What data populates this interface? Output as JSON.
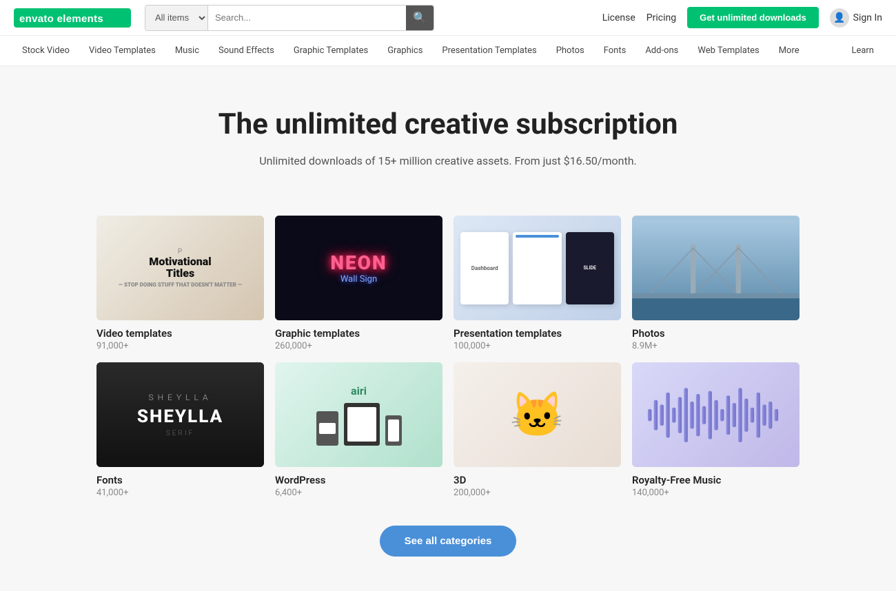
{
  "logo": {
    "text": "envato elements"
  },
  "search": {
    "dropdown_label": "All items",
    "placeholder": "Search..."
  },
  "top_nav": {
    "license": "License",
    "pricing": "Pricing",
    "get_unlimited": "Get unlimited downloads",
    "sign_in": "Sign In"
  },
  "secondary_nav": {
    "items": [
      "Stock Video",
      "Video Templates",
      "Music",
      "Sound Effects",
      "Graphic Templates",
      "Graphics",
      "Presentation Templates",
      "Photos",
      "Fonts",
      "Add-ons",
      "Web Templates",
      "More",
      "Learn"
    ]
  },
  "hero": {
    "title": "The unlimited creative subscription",
    "subtitle": "Unlimited downloads of 15+ million creative assets. From just $16.50/month."
  },
  "categories": [
    {
      "name": "Video templates",
      "count": "91,000+",
      "type": "video"
    },
    {
      "name": "Graphic templates",
      "count": "260,000+",
      "type": "graphic"
    },
    {
      "name": "Presentation templates",
      "count": "100,000+",
      "type": "presentation"
    },
    {
      "name": "Photos",
      "count": "8.9M+",
      "type": "photos"
    },
    {
      "name": "Fonts",
      "count": "41,000+",
      "type": "fonts"
    },
    {
      "name": "WordPress",
      "count": "6,400+",
      "type": "wordpress"
    },
    {
      "name": "3D",
      "count": "200,000+",
      "type": "3d"
    },
    {
      "name": "Royalty-Free Music",
      "count": "140,000+",
      "type": "music"
    }
  ],
  "cta": {
    "label": "See all categories"
  }
}
